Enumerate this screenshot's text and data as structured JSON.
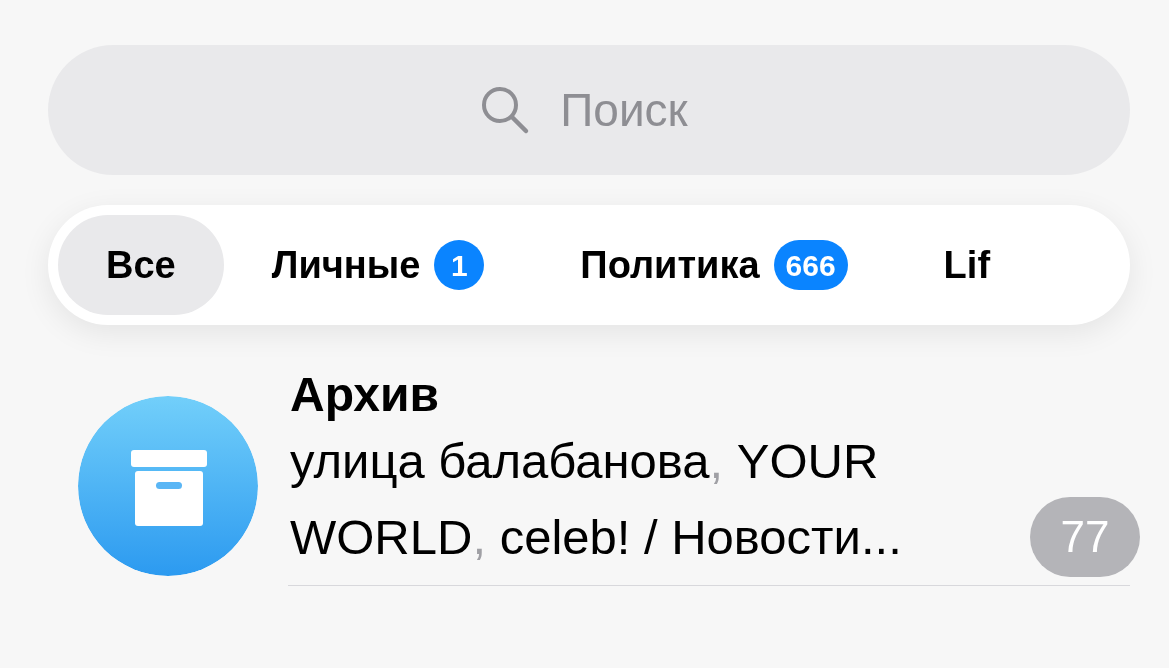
{
  "search": {
    "placeholder": "Поиск"
  },
  "folders": [
    {
      "label": "Все",
      "selected": true
    },
    {
      "label": "Личные",
      "selected": false,
      "badge": "1"
    },
    {
      "label": "Политика",
      "selected": false,
      "badge": "666"
    },
    {
      "label": "Lif",
      "selected": false
    }
  ],
  "chats": [
    {
      "title": "Архив",
      "kind": "archive",
      "unread": "77",
      "muted": true,
      "preview": [
        {
          "kind": "name",
          "text": "улица балабанова"
        },
        {
          "kind": "separator",
          "text": ", "
        },
        {
          "kind": "name",
          "text": "YOUR WORLD"
        },
        {
          "kind": "separator",
          "text": ", "
        },
        {
          "kind": "name",
          "text": "celeb! / Новости..."
        }
      ]
    }
  ]
}
